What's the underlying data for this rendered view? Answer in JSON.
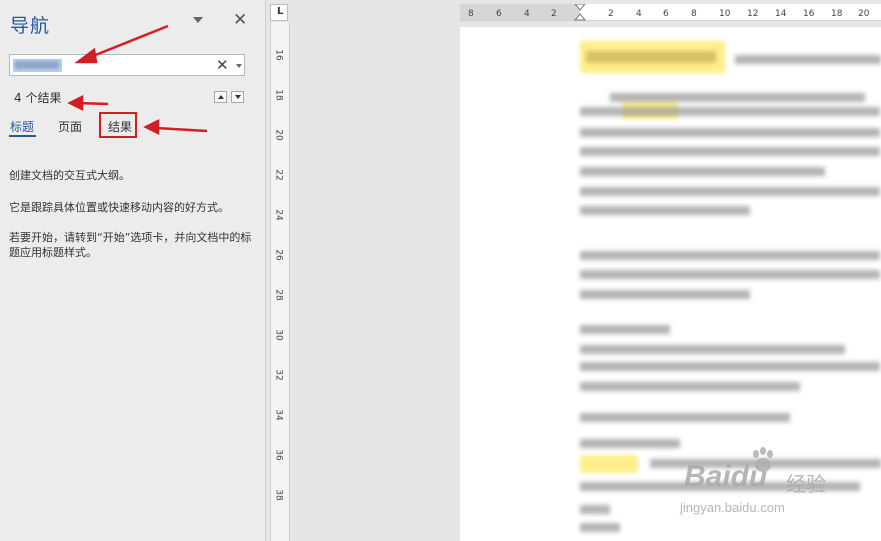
{
  "nav": {
    "title": "导航",
    "search_value": "",
    "results_count": "4 个结果",
    "tabs": [
      {
        "label": "标题",
        "active": true
      },
      {
        "label": "页面",
        "active": false
      },
      {
        "label": "结果",
        "active": false,
        "highlighted": true
      }
    ],
    "messages": [
      "创建文档的交互式大纲。",
      "它是跟踪具体位置或快速移动内容的好方式。",
      "若要开始，请转到“开始”选项卡，并向文档中的标题应用标题样式。"
    ]
  },
  "ruler": {
    "corner_symbol": "L",
    "horizontal_labels": [
      "8",
      "6",
      "4",
      "2",
      "2",
      "4",
      "6",
      "8",
      "10",
      "12",
      "14",
      "16",
      "18",
      "20"
    ],
    "vertical_labels": [
      "16",
      "18",
      "20",
      "22",
      "24",
      "26",
      "28",
      "30",
      "32",
      "34",
      "36",
      "38"
    ]
  },
  "watermark": {
    "brand": "Baidu",
    "brand_cn": "经验",
    "url": "jingyan.baidu.com"
  },
  "colors": {
    "accent": "#2b579a",
    "annotation_red": "#d21f26",
    "highlight_yellow": "#ffef8a"
  },
  "icons": {
    "close": "close-icon",
    "dropdown": "chevron-down-icon",
    "clear": "clear-icon",
    "prev_result": "triangle-up-icon",
    "next_result": "triangle-down-icon"
  }
}
